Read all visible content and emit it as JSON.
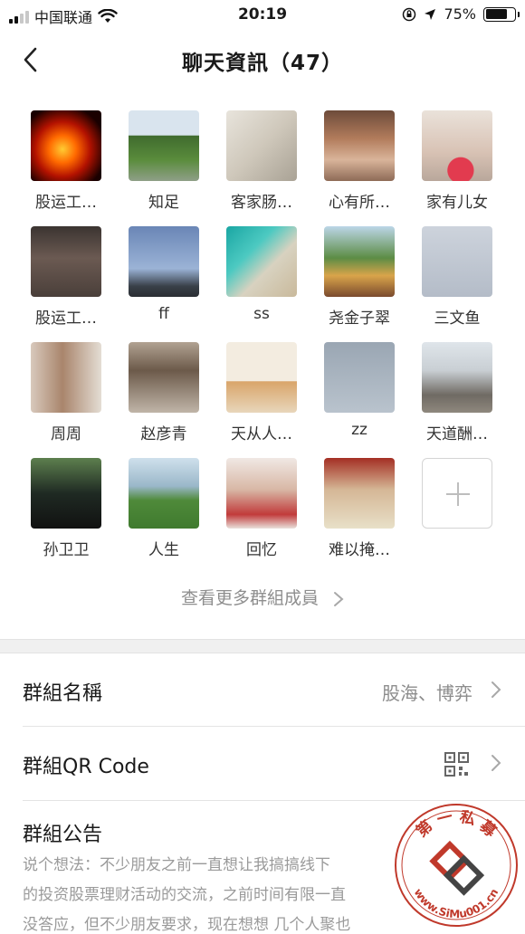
{
  "status_bar": {
    "carrier": "中国联通",
    "time": "20:19",
    "battery_percent": "75%",
    "battery_level": 0.75
  },
  "nav": {
    "title": "聊天資訊（47）"
  },
  "members": [
    {
      "name": "股运工…",
      "avatar": "fire-horse"
    },
    {
      "name": "知足",
      "avatar": "garden"
    },
    {
      "name": "客家肠…",
      "avatar": "sketch-portrait"
    },
    {
      "name": "心有所…",
      "avatar": "child-room"
    },
    {
      "name": "家有儿女",
      "avatar": "girl-heart"
    },
    {
      "name": "股运工…",
      "avatar": "cafe-man"
    },
    {
      "name": "ff",
      "avatar": "blue-sky"
    },
    {
      "name": "ss",
      "avatar": "beach"
    },
    {
      "name": "尧金子翠",
      "avatar": "playground"
    },
    {
      "name": "三文鱼",
      "avatar": "pale-sky"
    },
    {
      "name": "周周",
      "avatar": "woman-window"
    },
    {
      "name": "赵彦青",
      "avatar": "man-shop"
    },
    {
      "name": "天从人…",
      "avatar": "bao-art"
    },
    {
      "name": "zz",
      "avatar": "grey-sky"
    },
    {
      "name": "天道酬…",
      "avatar": "rock-people"
    },
    {
      "name": "孙卫卫",
      "avatar": "man-suit"
    },
    {
      "name": "人生",
      "avatar": "golfer"
    },
    {
      "name": "回忆",
      "avatar": "young-man"
    },
    {
      "name": "难以掩…",
      "avatar": "man-sunglasses"
    }
  ],
  "see_more": "查看更多群組成員",
  "rows": {
    "group_name_label": "群組名稱",
    "group_name_value": "股海、博弈",
    "qr_label": "群組QR Code"
  },
  "notice": {
    "title": "群組公告",
    "line1": "说个想法：不少朋友之前一直想让我搞搞线下",
    "line2": "的投资股票理财活动的交流，之前时间有限一直",
    "line3": "没答应，但不少朋友要求，现在想想 几个人聚也"
  },
  "watermark": {
    "top_text": "第 一 私 募",
    "url_text": "www.SiMu001.cn"
  },
  "colors": {
    "text_primary": "#1a1a1a",
    "text_secondary": "#8c8c8c",
    "divider": "#e4e4e4",
    "section_bg": "#f0f0f0",
    "watermark_red": "#c0392b"
  }
}
